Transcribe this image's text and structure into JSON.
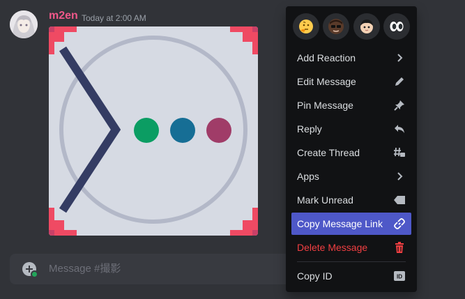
{
  "message": {
    "username": "m2en",
    "timestamp": "Today at 2:00 AM"
  },
  "composer": {
    "placeholder": "Message #撮影"
  },
  "context_menu": {
    "reactions": [
      "thinking-face-emoji",
      "custom-emoji-1",
      "custom-emoji-2",
      "eyes-emoji"
    ],
    "items": [
      {
        "label": "Add Reaction",
        "icon": "chevron-right-icon"
      },
      {
        "label": "Edit Message",
        "icon": "pencil-icon"
      },
      {
        "label": "Pin Message",
        "icon": "pin-icon"
      },
      {
        "label": "Reply",
        "icon": "reply-icon"
      },
      {
        "label": "Create Thread",
        "icon": "thread-icon"
      },
      {
        "label": "Apps",
        "icon": "chevron-right-icon"
      },
      {
        "label": "Mark Unread",
        "icon": "mark-unread-icon"
      },
      {
        "label": "Copy Message Link",
        "icon": "link-icon"
      },
      {
        "label": "Delete Message",
        "icon": "trash-icon"
      },
      {
        "label": "Copy ID",
        "icon": "id-icon"
      }
    ]
  },
  "colors": {
    "background": "#313338",
    "menu": "#111214",
    "highlight": "#4e58c8",
    "danger": "#f23f42",
    "username": "#f0588a"
  }
}
